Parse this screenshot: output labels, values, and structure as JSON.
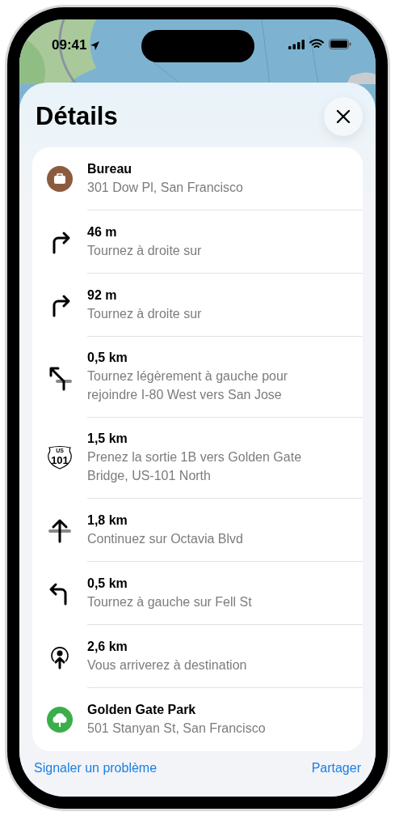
{
  "status_bar": {
    "time": "09:41"
  },
  "sheet": {
    "title": "Détails"
  },
  "steps": [
    {
      "kind": "work",
      "color": "#8c5b3e",
      "title": "Bureau",
      "subtitle": "301 Dow Pl, San Francisco"
    },
    {
      "kind": "turn-right",
      "title": "46 m",
      "subtitle": "Tournez à droite sur"
    },
    {
      "kind": "turn-right",
      "title": "92 m",
      "subtitle": "Tournez à droite sur"
    },
    {
      "kind": "slight-left",
      "title": "0,5 km",
      "subtitle": "Tournez légèrement à gauche pour rejoindre I-80 West vers San Jose"
    },
    {
      "kind": "highway",
      "shield_network": "US",
      "shield_number": "101",
      "title": "1,5 km",
      "subtitle": "Prenez la sortie 1B vers Golden Gate Bridge, US-101 North"
    },
    {
      "kind": "straight",
      "title": "1,8 km",
      "subtitle": "Continuez sur Octavia Blvd"
    },
    {
      "kind": "turn-left",
      "title": "0,5 km",
      "subtitle": "Tournez à gauche sur Fell St"
    },
    {
      "kind": "arrive",
      "title": "2,6 km",
      "subtitle": "Vous arriverez à destination"
    },
    {
      "kind": "park",
      "color": "#3aae4a",
      "title": "Golden Gate Park",
      "subtitle": "501 Stanyan St, San Francisco"
    }
  ],
  "footer": {
    "report_link": "Signaler un problème",
    "share_link": "Partager"
  }
}
